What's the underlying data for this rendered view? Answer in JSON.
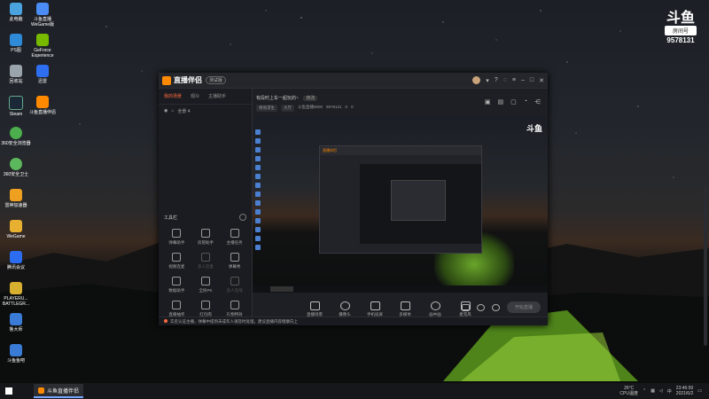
{
  "desktop": {
    "icons": [
      {
        "label": "此电脑",
        "color": "#4aa3df"
      },
      {
        "label": "斗鱼直播\nWeGame版",
        "color": "#4b8cf5"
      },
      {
        "label": "PS图",
        "color": "#2f8ad8"
      },
      {
        "label": "GeForce\nExperience",
        "color": "#76b900"
      },
      {
        "label": "回收站",
        "color": "#9aa4ad"
      },
      {
        "label": "迅雷",
        "color": "#2e6ff2"
      },
      {
        "label": "Steam",
        "color": "#1b2838"
      },
      {
        "label": "斗鱼直播伴侣",
        "color": "#ff8a00"
      },
      {
        "label": "360安全浏览器",
        "color": "#4cae4c"
      },
      {
        "label": "360安全卫士",
        "color": "#5cb85c"
      },
      {
        "label": "雷神加速器",
        "color": "#f0a020"
      },
      {
        "label": "WeGame",
        "color": "#e8b030"
      },
      {
        "label": "腾讯会议",
        "color": "#2b6cf0"
      },
      {
        "label": "PLAYERU...\nBATTLEGR...",
        "color": "#d8b030"
      },
      {
        "label": "鲁大师",
        "color": "#3a7bd5"
      },
      {
        "label": "斗鱼鱼吧",
        "color": "#3a7bd5"
      }
    ],
    "douyu_logo": {
      "mark": "斗鱼",
      "room_tag": "房间号",
      "room_num": "9578131"
    }
  },
  "app": {
    "name": "直播伴侣",
    "version": "测试版",
    "tabs": [
      "我的场景",
      "观众",
      "主播助手"
    ],
    "scene": "全景 4",
    "stream_title": "有段时上车一起玩的~",
    "edit_label": "修改",
    "meta": [
      "绝地求生",
      "大厅",
      "斗鱼直播9000",
      "9578131",
      "0",
      "0"
    ],
    "tools_title": "工具栏",
    "tools": [
      {
        "label": "弹幕助手",
        "dim": false
      },
      {
        "label": "房管助手",
        "dim": false
      },
      {
        "label": "主播任务",
        "dim": false
      },
      {
        "label": "视频连麦",
        "dim": false
      },
      {
        "label": "多人连麦",
        "dim": true
      },
      {
        "label": "弹幕秀",
        "dim": false
      },
      {
        "label": "数据助手",
        "dim": false
      },
      {
        "label": "全民PK",
        "dim": false
      },
      {
        "label": "多人连线",
        "dim": true
      },
      {
        "label": "直播抽奖",
        "dim": false
      },
      {
        "label": "红包雨",
        "dim": false
      },
      {
        "label": "礼物特效",
        "dim": false
      }
    ],
    "controls": [
      "直播场景",
      "摄像头",
      "手机投屏",
      "多媒体",
      "画中画",
      "麦克风"
    ],
    "start_label": "开始直播",
    "notice": "实名认证主播，弹幕中提到未成年人请及时处理，建议直播内容健康向上"
  },
  "taskbar": {
    "running_app": "斗鱼直播伴侣",
    "weather_temp": "26°C",
    "weather_label": "CPU温度",
    "time": "23:46:50",
    "date": "2021/6/2"
  },
  "colors": {
    "accent": "#ff6a3d",
    "brand": "#ff8a00"
  }
}
